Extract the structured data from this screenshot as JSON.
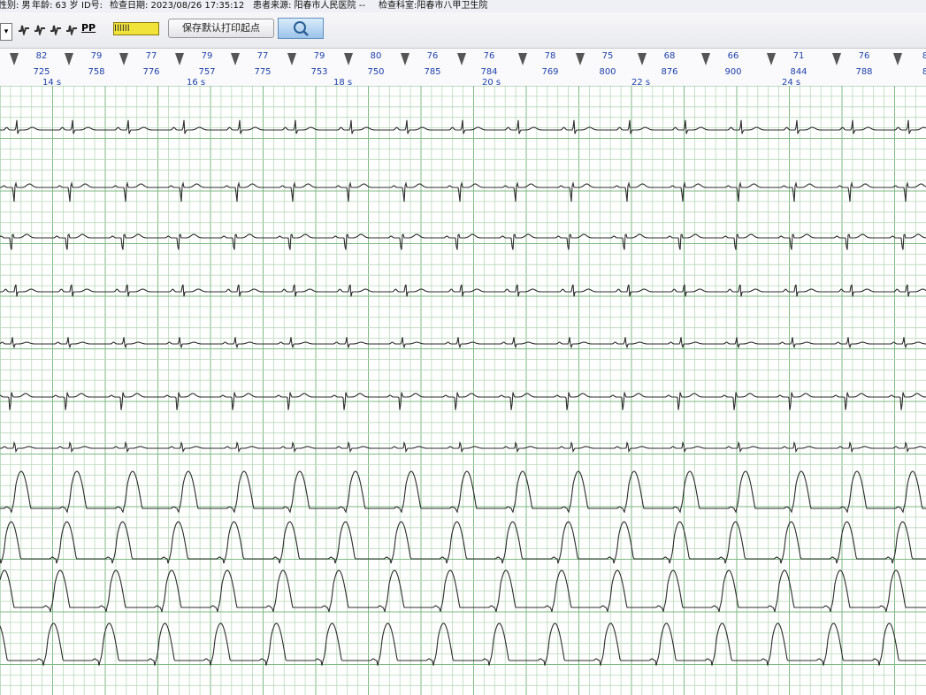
{
  "patient_info": {
    "gender": "性别: 男",
    "age": "年龄: 63 岁",
    "id": "ID号:",
    "exam_date": "检查日期: 2023/08/26 17:35:12",
    "source": "患者来源: 阳春市人民医院 --",
    "exam_dept": "检查科室:阳春市八甲卫生院"
  },
  "toolbar": {
    "dropdown_glyph": "▾",
    "pp_label": "PP",
    "ruler_text": "ⅠⅠⅠⅠⅠⅠ",
    "save_print_start_label": "保存默认打印起点",
    "icons": [
      "waveform-icon",
      "waveform-icon",
      "waveform-icon",
      "waveform-icon",
      "search-icon"
    ]
  },
  "beat_annotations": [
    {
      "hr": "82",
      "rr": "725"
    },
    {
      "hr": "79",
      "rr": "758"
    },
    {
      "hr": "77",
      "rr": "776"
    },
    {
      "hr": "79",
      "rr": "757"
    },
    {
      "hr": "77",
      "rr": "775"
    },
    {
      "hr": "79",
      "rr": "753"
    },
    {
      "hr": "80",
      "rr": "750"
    },
    {
      "hr": "76",
      "rr": "785"
    },
    {
      "hr": "76",
      "rr": "784"
    },
    {
      "hr": "78",
      "rr": "769"
    },
    {
      "hr": "75",
      "rr": "800"
    },
    {
      "hr": "68",
      "rr": "876"
    },
    {
      "hr": "66",
      "rr": "900"
    },
    {
      "hr": "71",
      "rr": "844"
    },
    {
      "hr": "76",
      "rr": "788"
    },
    {
      "hr": "8",
      "rr": "8"
    }
  ],
  "time_marks": [
    "14 s",
    "16 s",
    "18 s",
    "20 s",
    "22 s",
    "24 s"
  ],
  "colors": {
    "grid_minor": "#b9d8bb",
    "grid_major": "#7fba85",
    "paper": "#ffffff",
    "trace": "#2d2d2d",
    "annotation_text": "#1d3fa8",
    "marker": "#555555"
  }
}
